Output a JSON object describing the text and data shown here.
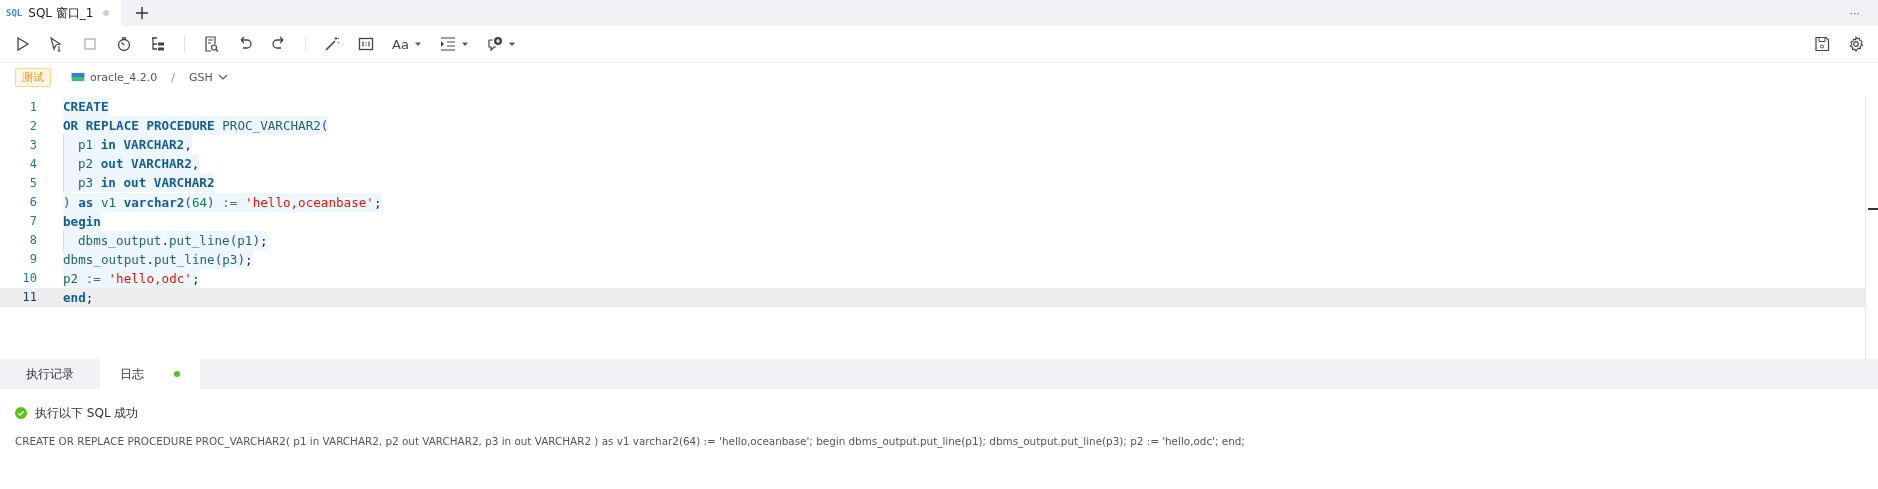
{
  "tabs": [
    {
      "label": "SQL 窗口_1",
      "icon_text": "SQL",
      "selected": true
    }
  ],
  "more_text": "···",
  "toolbar": {
    "font_label": "Aa"
  },
  "breadcrumb": {
    "env_tag": "测试",
    "connection": "oracle_4.2.0",
    "separator": "/",
    "schema": "GSH"
  },
  "editor": {
    "lines": [
      {
        "number": "1",
        "indented": false,
        "current": false,
        "tokens": [
          {
            "kind": "kw",
            "text": "CREATE"
          }
        ]
      },
      {
        "number": "2",
        "indented": false,
        "current": false,
        "tokens": [
          {
            "kind": "kw",
            "text": "OR REPLACE PROCEDURE "
          },
          {
            "kind": "id",
            "text": "PROC_VARCHAR2"
          },
          {
            "kind": "paren",
            "text": "("
          }
        ]
      },
      {
        "number": "3",
        "indented": true,
        "current": false,
        "tokens": [
          {
            "kind": "id",
            "text": "p1 "
          },
          {
            "kind": "kw",
            "text": "in VARCHAR2"
          },
          {
            "kind": "plain",
            "text": ","
          }
        ]
      },
      {
        "number": "4",
        "indented": true,
        "current": false,
        "tokens": [
          {
            "kind": "id",
            "text": "p2 "
          },
          {
            "kind": "kw",
            "text": "out VARCHAR2"
          },
          {
            "kind": "plain",
            "text": ","
          }
        ]
      },
      {
        "number": "5",
        "indented": true,
        "current": false,
        "tokens": [
          {
            "kind": "id",
            "text": "p3 "
          },
          {
            "kind": "kw",
            "text": "in out VARCHAR2"
          }
        ]
      },
      {
        "number": "6",
        "indented": false,
        "current": false,
        "tokens": [
          {
            "kind": "paren",
            "text": ") "
          },
          {
            "kind": "kw",
            "text": "as "
          },
          {
            "kind": "id",
            "text": "v1 "
          },
          {
            "kind": "kw",
            "text": "varchar2"
          },
          {
            "kind": "paren",
            "text": "("
          },
          {
            "kind": "num",
            "text": "64"
          },
          {
            "kind": "paren",
            "text": ")"
          },
          {
            "kind": "op",
            "text": " := "
          },
          {
            "kind": "str",
            "text": "'hello,oceanbase'"
          },
          {
            "kind": "plain",
            "text": ";"
          }
        ]
      },
      {
        "number": "7",
        "indented": false,
        "current": false,
        "tokens": [
          {
            "kind": "kw",
            "text": "begin"
          }
        ]
      },
      {
        "number": "8",
        "indented": true,
        "current": false,
        "tokens": [
          {
            "kind": "id",
            "text": "dbms_output"
          },
          {
            "kind": "plain",
            "text": "."
          },
          {
            "kind": "id",
            "text": "put_line"
          },
          {
            "kind": "paren",
            "text": "("
          },
          {
            "kind": "id",
            "text": "p1"
          },
          {
            "kind": "paren",
            "text": ")"
          },
          {
            "kind": "plain",
            "text": ";"
          }
        ]
      },
      {
        "number": "9",
        "indented": false,
        "current": false,
        "tokens": [
          {
            "kind": "id",
            "text": "dbms_output"
          },
          {
            "kind": "plain",
            "text": "."
          },
          {
            "kind": "id",
            "text": "put_line"
          },
          {
            "kind": "paren",
            "text": "("
          },
          {
            "kind": "id",
            "text": "p3"
          },
          {
            "kind": "paren",
            "text": ")"
          },
          {
            "kind": "plain",
            "text": ";"
          }
        ]
      },
      {
        "number": "10",
        "indented": false,
        "current": false,
        "tokens": [
          {
            "kind": "id",
            "text": "p2"
          },
          {
            "kind": "op",
            "text": " := "
          },
          {
            "kind": "str",
            "text": "'hello,odc'"
          },
          {
            "kind": "plain",
            "text": ";"
          }
        ]
      },
      {
        "number": "11",
        "indented": false,
        "current": true,
        "tokens": [
          {
            "kind": "kw",
            "text": "end"
          },
          {
            "kind": "plain",
            "text": ";"
          }
        ]
      }
    ]
  },
  "result_tabs": [
    {
      "label": "执行记录",
      "selected": false,
      "has_dot": false
    },
    {
      "label": "日志",
      "selected": true,
      "has_dot": true
    }
  ],
  "log": {
    "succeeded": true,
    "message": "执行以下 SQL 成功",
    "sql": "CREATE OR REPLACE PROCEDURE PROC_VARCHAR2( p1 in VARCHAR2, p2 out VARCHAR2, p3 in out VARCHAR2 ) as v1 varchar2(64) := 'hello,oceanbase'; begin dbms_output.put_line(p1); dbms_output.put_line(p3); p2 := 'hello,odc'; end;"
  }
}
